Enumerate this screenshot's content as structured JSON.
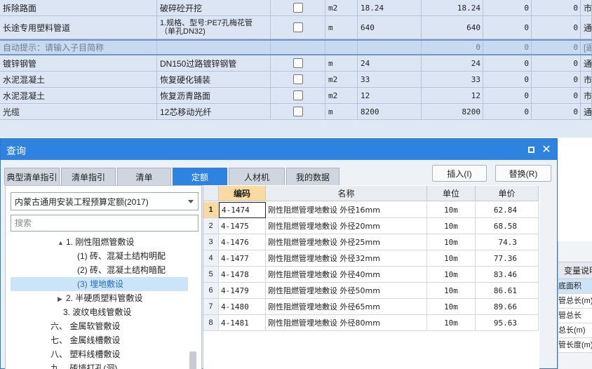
{
  "bg_rows": [
    {
      "name": "拆除路面",
      "desc": "破碎砼开挖",
      "unit": "m2",
      "qty": "18.24",
      "amount": "18.24",
      "c1": "0",
      "c2": "0",
      "last": "市"
    },
    {
      "name": "长途专用塑料管道",
      "desc": "1.规格、型号:PE7孔梅花管（单孔DN32)",
      "unit": "m",
      "qty": "640",
      "amount": "640",
      "c1": "0",
      "c2": "0",
      "last": "通"
    },
    {
      "name": "自动提示：请输入子目简称",
      "desc": "",
      "unit": "",
      "qty": "",
      "amount": "0",
      "c1": "0",
      "c2": "0",
      "last": "[遁"
    },
    {
      "name": "镀锌钢管",
      "desc": "DN150过路镀锌钢管",
      "unit": "m",
      "qty": "24",
      "amount": "24",
      "c1": "0",
      "c2": "0",
      "last": "通"
    },
    {
      "name": "水泥混凝土",
      "desc": "恢复硬化铺装",
      "unit": "m2",
      "qty": "33",
      "amount": "33",
      "c1": "0",
      "c2": "0",
      "last": "市"
    },
    {
      "name": "水泥混凝土",
      "desc": "恢复沥青路面",
      "unit": "m2",
      "qty": "12",
      "amount": "12",
      "c1": "0",
      "c2": "0",
      "last": "市"
    },
    {
      "name": "光缆",
      "desc": "12芯移动光纤",
      "unit": "m",
      "qty": "8200",
      "amount": "8200",
      "c1": "0",
      "c2": "0",
      "last": "通"
    }
  ],
  "right_panel": {
    "title": "变量说明",
    "rows": [
      "底面积",
      "管总长(m)",
      "管总长",
      "总长(m)",
      "管长度(m)"
    ]
  },
  "dialog": {
    "title": "查询",
    "tabs": [
      {
        "label": "典型清单指引",
        "active": false
      },
      {
        "label": "清单指引",
        "active": false
      },
      {
        "label": "清单",
        "active": false
      },
      {
        "label": "定额",
        "active": true
      },
      {
        "label": "人材机",
        "active": false
      },
      {
        "label": "我的数据",
        "active": false
      }
    ],
    "insert_label": "插入(I)",
    "replace_label": "替换(R)",
    "quota_library": "内蒙古通用安装工程预算定额(2017)",
    "search_placeholder": "搜索",
    "tree": [
      {
        "label": "1. 刚性阻燃管敷设",
        "arrow": "▲",
        "selected": false
      },
      {
        "label": "(1) 砖、混凝土结构明配",
        "arrow": "",
        "selected": false
      },
      {
        "label": "(2) 砖、混凝土结构暗配",
        "arrow": "",
        "selected": false
      },
      {
        "label": "(3) 埋地敷设",
        "arrow": "",
        "selected": true
      },
      {
        "label": "2. 半硬质塑料管敷设",
        "arrow": "▶",
        "selected": false
      },
      {
        "label": "3. 波纹电线管敷设",
        "arrow": "",
        "selected": false
      },
      {
        "label": "六、  金属软管敷设",
        "arrow": "",
        "selected": false
      },
      {
        "label": "七、  金属线槽敷设",
        "arrow": "",
        "selected": false
      },
      {
        "label": "八、  塑料线槽敷设",
        "arrow": "",
        "selected": false
      },
      {
        "label": "九、  砖墙打孔(洞)",
        "arrow": "",
        "selected": false
      }
    ],
    "table": {
      "headers": {
        "code": "编码",
        "name": "名称",
        "unit": "单位",
        "price": "单价"
      },
      "rows": [
        {
          "idx": "1",
          "code": "4-1474",
          "name": "刚性阻燃管埋地敷设 外径16mm",
          "unit": "10m",
          "price": "62.84"
        },
        {
          "idx": "2",
          "code": "4-1475",
          "name": "刚性阻燃管埋地敷设 外径20mm",
          "unit": "10m",
          "price": "68.58"
        },
        {
          "idx": "3",
          "code": "4-1476",
          "name": "刚性阻燃管埋地敷设 外径25mm",
          "unit": "10m",
          "price": "74.3"
        },
        {
          "idx": "4",
          "code": "4-1477",
          "name": "刚性阻燃管埋地敷设 外径32mm",
          "unit": "10m",
          "price": "77.36"
        },
        {
          "idx": "5",
          "code": "4-1478",
          "name": "刚性阻燃管埋地敷设 外径40mm",
          "unit": "10m",
          "price": "83.46"
        },
        {
          "idx": "6",
          "code": "4-1479",
          "name": "刚性阻燃管埋地敷设 外径50mm",
          "unit": "10m",
          "price": "86.61"
        },
        {
          "idx": "7",
          "code": "4-1480",
          "name": "刚性阻燃管埋地敷设 外径65mm",
          "unit": "10m",
          "price": "89.66"
        },
        {
          "idx": "8",
          "code": "4-1481",
          "name": "刚性阻燃管埋地敷设 外径80mm",
          "unit": "10m",
          "price": "95.63"
        }
      ]
    }
  },
  "colors": {
    "accent": "#2f83e0",
    "header_highlight": "#f9dba1",
    "selection": "#cce4f7"
  }
}
